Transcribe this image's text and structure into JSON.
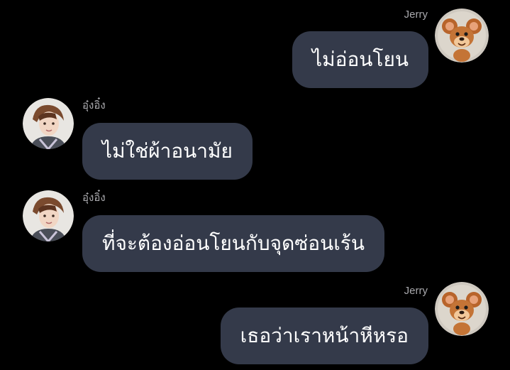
{
  "chat": {
    "messages": [
      {
        "sender": "Jerry",
        "side": "right",
        "avatar_icon": "jerry-mouse-avatar-icon",
        "text": "ไม่อ่อนโยน"
      },
      {
        "sender": "อุ๋งอิ๋ง",
        "side": "left",
        "avatar_icon": "profile-photo-avatar-icon",
        "text": "ไม่ใช่ผ้าอนามัย"
      },
      {
        "sender": "อุ๋งอิ๋ง",
        "side": "left",
        "avatar_icon": "profile-photo-avatar-icon",
        "text": "ที่จะต้องอ่อนโยนกับจุดซ่อนเร้น"
      },
      {
        "sender": "Jerry",
        "side": "right",
        "avatar_icon": "jerry-mouse-avatar-icon",
        "text": "เธอว่าเราหน้าหีหรอ"
      }
    ]
  },
  "colors": {
    "background": "#000000",
    "bubble": "#343a4a",
    "bubble_text": "#ffffff",
    "name_text": "#a9a9ad"
  }
}
